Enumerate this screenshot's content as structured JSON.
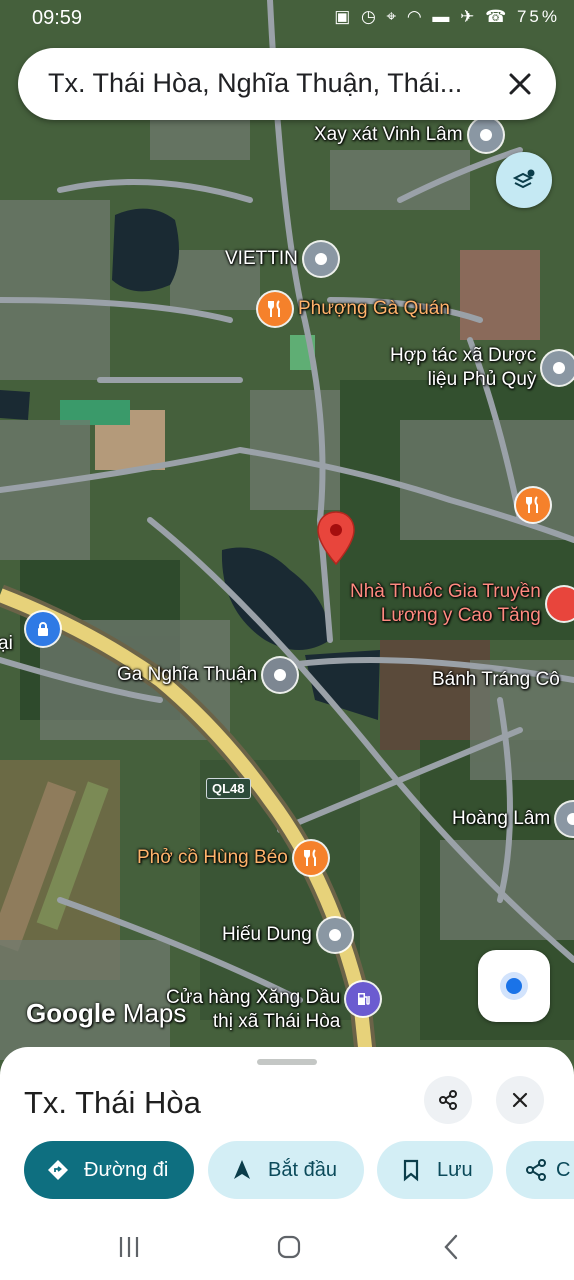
{
  "status_bar": {
    "time": "09:59",
    "icons": "▣ ◷ ⌖ ◠ ▬ ✈ ☎ 75%"
  },
  "search": {
    "query": "Tx. Thái Hòa, Nghĩa Thuận, Thái..."
  },
  "map": {
    "pois": [
      {
        "label": "Xay xát Vinh Lâm",
        "icon": "pin-icon"
      },
      {
        "label": "VIETTIN",
        "icon": "pin-icon"
      },
      {
        "label": "Phượng Gà Quán",
        "icon": "restaurant-icon"
      },
      {
        "label_1": "Hợp tác xã Dược",
        "label_2": "liệu Phủ Quỳ",
        "icon": "pin-icon"
      },
      {
        "label_1": "Nhà Thuốc Gia Truyền",
        "label_2": "Lương y Cao Tăng",
        "icon": "pharmacy-icon"
      },
      {
        "label": "Ga Nghĩa Thuận",
        "icon": "train-icon"
      },
      {
        "label": "Bánh Tráng Cô",
        "icon": "pin-icon"
      },
      {
        "label": "Hoàng Lâm",
        "icon": "pin-icon"
      },
      {
        "label": "Phở cồ Hùng Béo",
        "icon": "restaurant-icon"
      },
      {
        "label": "Hiếu Dung",
        "icon": "pin-icon"
      },
      {
        "label_1": "Cửa hàng Xăng Dầu",
        "label_2": "thị xã Thái Hòa",
        "icon": "gas-station-icon"
      },
      {
        "label": "ại",
        "icon": "lock-icon"
      }
    ],
    "road_badge": "QL48",
    "logo_google": "Google",
    "logo_maps": "Maps"
  },
  "sheet": {
    "title": "Tx. Thái Hòa",
    "actions": {
      "directions": "Đường đi",
      "start": "Bắt đầu",
      "save": "Lưu",
      "share": "C"
    }
  },
  "colors": {
    "primary": "#0e6f80",
    "chip_bg": "#d3eef5",
    "pin_red": "#e8453c"
  }
}
